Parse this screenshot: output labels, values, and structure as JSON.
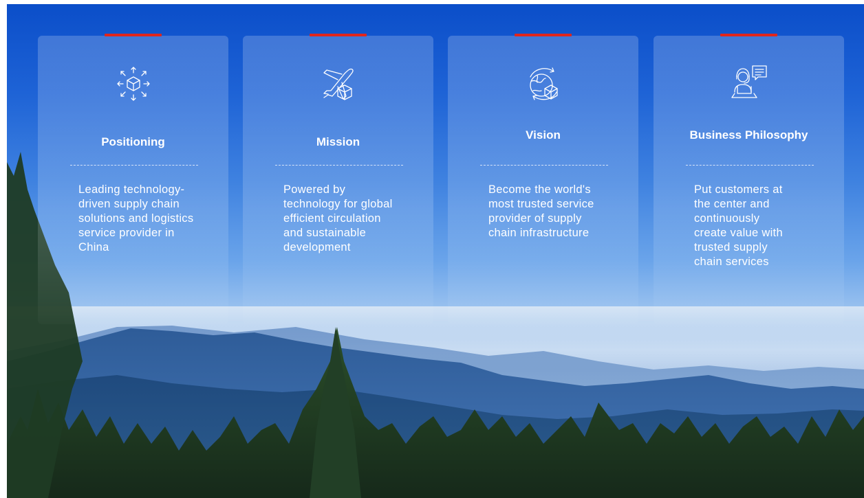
{
  "cards": [
    {
      "icon": "box-arrows-icon",
      "title": "Positioning",
      "description": "Leading technology-driven supply chain solutions and logistics service provider in China"
    },
    {
      "icon": "airplane-box-icon",
      "title": "Mission",
      "description": "Powered by technology for global efficient circulation and sustainable development"
    },
    {
      "icon": "globe-box-icon",
      "title": "Vision",
      "description": "Become the world's most trusted service provider of supply chain infrastructure"
    },
    {
      "icon": "customer-service-icon",
      "title": "Business Philosophy",
      "description": "Put customers at the center and continuously create value with trusted supply chain services"
    }
  ],
  "colors": {
    "accent": "#e1251b",
    "sky_top": "#0b4ec9",
    "text": "#ffffff"
  }
}
